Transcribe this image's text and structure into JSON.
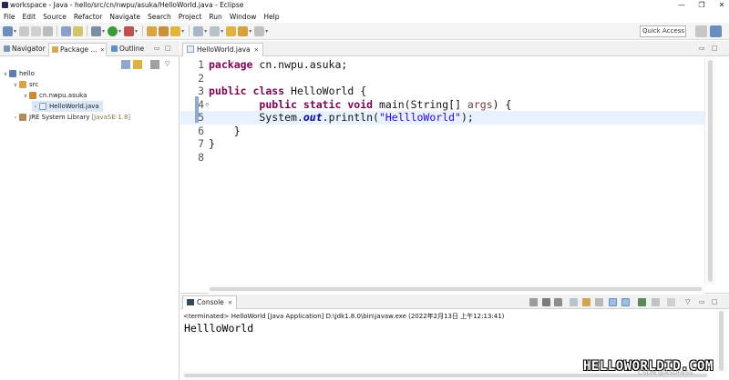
{
  "window": {
    "title": "workspace - Java - hello/src/cn/nwpu/asuka/HelloWorld.java - Eclipse",
    "minimize_glyph": "—",
    "restore_glyph": "❐",
    "close_glyph": "✕"
  },
  "menu": {
    "items": [
      "File",
      "Edit",
      "Source",
      "Refactor",
      "Navigate",
      "Search",
      "Project",
      "Run",
      "Window",
      "Help"
    ]
  },
  "toolbar": {
    "quick_access_placeholder": "Quick Access"
  },
  "left_panel": {
    "tabs": [
      {
        "label": "Navigator",
        "icon": "navigator-icon"
      },
      {
        "label": "Package ...",
        "icon": "package-explorer-icon"
      },
      {
        "label": "Outline",
        "icon": "outline-icon"
      }
    ],
    "close_glyph": "✕",
    "minimize_glyph": "▭",
    "maximize_glyph": "□",
    "tree": {
      "project": "hello",
      "src_folder": "src",
      "package": "cn.nwpu.asuka",
      "file": "HelloWorld.java",
      "library": "JRE System Library",
      "library_decoration": "[JavaSE-1.8]"
    }
  },
  "editor": {
    "tab_label": "HelloWorld.java",
    "close_glyph": "✕",
    "current_line": 5,
    "lines": [
      {
        "num": "1",
        "tokens": [
          {
            "t": "package",
            "c": "kw"
          },
          {
            "t": " cn.nwpu.asuka;",
            "c": ""
          }
        ]
      },
      {
        "num": "2",
        "tokens": []
      },
      {
        "num": "3",
        "tokens": [
          {
            "t": "public",
            "c": "kw"
          },
          {
            "t": " ",
            "c": ""
          },
          {
            "t": "class",
            "c": "kw"
          },
          {
            "t": " HelloWorld {",
            "c": ""
          }
        ]
      },
      {
        "num": "4",
        "tokens": [
          {
            "t": "        ",
            "c": ""
          },
          {
            "t": "public",
            "c": "kw"
          },
          {
            "t": " ",
            "c": ""
          },
          {
            "t": "static",
            "c": "kw"
          },
          {
            "t": " ",
            "c": ""
          },
          {
            "t": "void",
            "c": "kw"
          },
          {
            "t": " main(String[] ",
            "c": ""
          },
          {
            "t": "args",
            "c": "param"
          },
          {
            "t": ") {",
            "c": ""
          }
        ]
      },
      {
        "num": "5",
        "tokens": [
          {
            "t": "        System.",
            "c": ""
          },
          {
            "t": "out",
            "c": "fld"
          },
          {
            "t": ".println(",
            "c": ""
          },
          {
            "t": "\"HellloWorld\"",
            "c": "str"
          },
          {
            "t": ");",
            "c": ""
          }
        ]
      },
      {
        "num": "6",
        "tokens": [
          {
            "t": "    }",
            "c": ""
          }
        ]
      },
      {
        "num": "7",
        "tokens": [
          {
            "t": "}",
            "c": ""
          }
        ]
      },
      {
        "num": "8",
        "tokens": []
      }
    ]
  },
  "console": {
    "tab_label": "Console",
    "close_glyph": "✕",
    "status": "<terminated> HelloWorld [Java Application] D:\\jdk1.8.0\\bin\\javaw.exe (2022年2月13日 上午12:13:41)",
    "output": "HellloWorld"
  },
  "watermark": {
    "main": "HELLOWORLDID.COM",
    "sub": "CSDN @ASUFASS"
  },
  "colors": {
    "keyword": "#7f0055",
    "string": "#2a00ff",
    "static_field": "#0000c0",
    "current_line_bg": "#e8f2fe",
    "selection_bg": "#dbe8f8"
  }
}
